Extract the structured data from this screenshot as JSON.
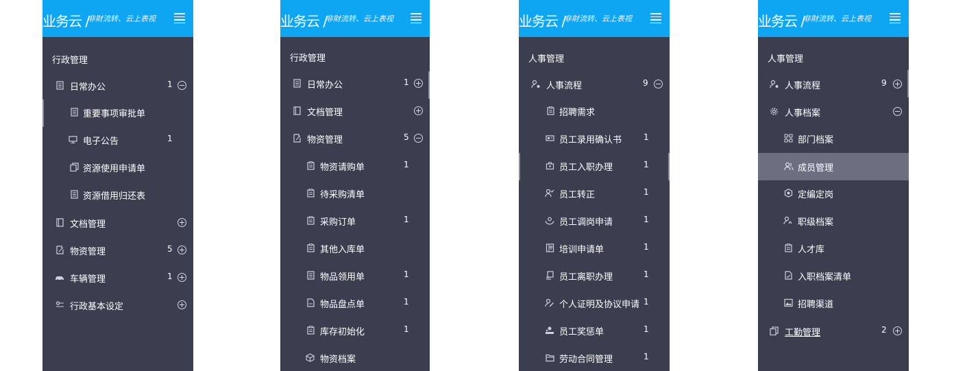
{
  "header": {
    "brand": "业务云 /",
    "slogan": "非財流转、云上表视",
    "menu_icon": "hamburger-icon",
    "colors": {
      "header_bg": "#0ea5f2",
      "sidebar_bg": "#3a3e4f",
      "active_bg": "#6b6f80"
    }
  },
  "panels": [
    {
      "section": "行政管理",
      "items": [
        {
          "label": "日常办公",
          "count": "1",
          "toggle": "collapse",
          "icon": "document-icon"
        },
        {
          "label": "重要事项审批单",
          "count": "",
          "icon": "document-icon"
        },
        {
          "label": "电子公告",
          "count": "1",
          "icon": "monitor-icon"
        },
        {
          "label": "资源使用申请单",
          "count": "",
          "icon": "copy-icon"
        },
        {
          "label": "资源借用归还表",
          "count": "",
          "icon": "document-icon"
        },
        {
          "label": "文档管理",
          "count": "",
          "toggle": "expand",
          "icon": "book-icon"
        },
        {
          "label": "物资管理",
          "count": "5",
          "toggle": "expand",
          "icon": "edit-icon"
        },
        {
          "label": "车辆管理",
          "count": "1",
          "toggle": "expand",
          "icon": "car-icon"
        },
        {
          "label": "行政基本设定",
          "count": "",
          "toggle": "expand",
          "icon": "settings-icon"
        }
      ]
    },
    {
      "section": "行政管理",
      "items": [
        {
          "label": "日常办公",
          "count": "1",
          "toggle": "expand",
          "icon": "document-icon"
        },
        {
          "label": "文档管理",
          "count": "",
          "toggle": "expand",
          "icon": "book-icon"
        },
        {
          "label": "物资管理",
          "count": "5",
          "toggle": "collapse",
          "icon": "edit-icon"
        },
        {
          "label": "物资请购单",
          "count": "1",
          "icon": "clipboard-icon"
        },
        {
          "label": "待采购清单",
          "count": "",
          "icon": "clipboard-icon"
        },
        {
          "label": "采购订单",
          "count": "1",
          "icon": "clipboard-icon"
        },
        {
          "label": "其他入库单",
          "count": "",
          "icon": "clipboard-icon"
        },
        {
          "label": "物品领用单",
          "count": "1",
          "icon": "document-icon"
        },
        {
          "label": "物品盘点单",
          "count": "1",
          "icon": "file-icon"
        },
        {
          "label": "库存初始化",
          "count": "1",
          "icon": "clipboard-icon"
        },
        {
          "label": "物资档案",
          "count": "",
          "icon": "cube-icon"
        }
      ]
    },
    {
      "section": "人事管理",
      "items": [
        {
          "label": "人事流程",
          "count": "9",
          "toggle": "collapse",
          "icon": "user-gear-icon"
        },
        {
          "label": "招聘需求",
          "count": "",
          "icon": "clipboard-icon"
        },
        {
          "label": "员工录用确认书",
          "count": "1",
          "icon": "id-card-icon"
        },
        {
          "label": "员工入职办理",
          "count": "1",
          "icon": "briefcase-icon"
        },
        {
          "label": "员工转正",
          "count": "1",
          "icon": "user-check-icon"
        },
        {
          "label": "员工调岗申请",
          "count": "1",
          "icon": "transfer-icon"
        },
        {
          "label": "培训申请单",
          "count": "1",
          "icon": "training-icon"
        },
        {
          "label": "员工离职办理",
          "count": "1",
          "icon": "exit-icon"
        },
        {
          "label": "个人证明及协议申请",
          "count": "1",
          "icon": "user-sign-icon"
        },
        {
          "label": "员工奖惩单",
          "count": "1",
          "icon": "award-icon"
        },
        {
          "label": "劳动合同管理",
          "count": "1",
          "icon": "folder-icon"
        }
      ]
    },
    {
      "section": "人事管理",
      "items": [
        {
          "label": "人事流程",
          "count": "9",
          "toggle": "expand",
          "icon": "user-gear-icon"
        },
        {
          "label": "人事档案",
          "count": "",
          "toggle": "collapse",
          "icon": "gear-icon"
        },
        {
          "label": "部门档案",
          "count": "",
          "icon": "org-chart-icon"
        },
        {
          "label": "成员管理",
          "count": "",
          "icon": "users-icon",
          "active": true
        },
        {
          "label": "定编定岗",
          "count": "",
          "icon": "badge-icon"
        },
        {
          "label": "职级档案",
          "count": "",
          "icon": "user-level-icon"
        },
        {
          "label": "人才库",
          "count": "",
          "icon": "clipboard-icon"
        },
        {
          "label": "入职档案清单",
          "count": "",
          "icon": "file-check-icon"
        },
        {
          "label": "招聘渠道",
          "count": "",
          "icon": "image-icon"
        },
        {
          "label": "工勤管理",
          "count": "2",
          "toggle": "expand",
          "icon": "copy-icon"
        }
      ]
    }
  ]
}
